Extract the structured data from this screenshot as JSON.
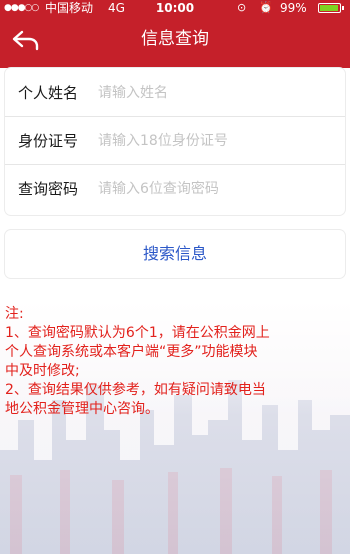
{
  "status_bar": {
    "carrier": "中国移动",
    "network": "4G",
    "time": "10:00",
    "battery": "99%",
    "battery_color": "#7ed321"
  },
  "nav": {
    "title": "信息查询",
    "back_icon": "back-arrow-icon"
  },
  "form": {
    "name_label": "个人姓名",
    "name_placeholder": "请输入姓名",
    "name_value": "",
    "id_label": "身份证号",
    "id_placeholder": "请输入18位身份证号",
    "id_value": "",
    "password_label": "查询密码",
    "password_placeholder": "请输入6位查询密码",
    "password_value": ""
  },
  "search_button": "搜索信息",
  "notes": {
    "title": "注:",
    "line1": "1、查询密码默认为6个1，请在公积金网上",
    "line2": "个人查询系统或本客户端“更多”功能模块",
    "line3": "中及时修改;",
    "line4": "2、查询结果仅供参考，如有疑问请致电当",
    "line5": "地公积金管理中心咨询。"
  },
  "colors": {
    "header": "#c5202a",
    "note_text": "#e2211c",
    "search_text": "#2c58c8"
  }
}
